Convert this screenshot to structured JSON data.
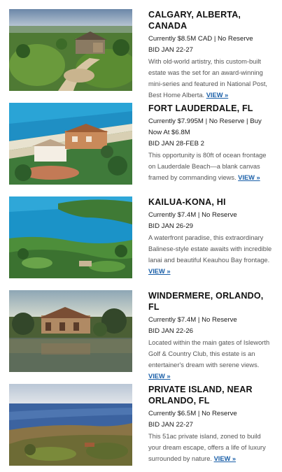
{
  "listings": [
    {
      "title": "CALGARY, ALBERTA, CANADA",
      "price": "Currently $8.5M CAD | No Reserve",
      "bid": "BID JAN 22-27",
      "description": "With old-world artistry, this custom-built estate was the set for an award-winning mini-series and featured in National Post, Best Home Alberta.",
      "link": "VIEW »",
      "image": "calgary-estate-photo"
    },
    {
      "title": "FORT LAUDERDALE, FL",
      "price": "Currently $7.995M | No Reserve | Buy Now At $6.8M",
      "bid": "BID JAN 28-FEB 2",
      "description": "This opportunity is 80ft of ocean frontage on Lauderdale Beach—a blank canvas framed by commanding views.",
      "link": "VIEW »",
      "image": "fort-lauderdale-beach-photo"
    },
    {
      "title": "KAILUA-KONA, HI",
      "price": "Currently $7.4M | No Reserve",
      "bid": "BID JAN 26-29",
      "description": "A waterfront paradise, this extraordinary Balinese-style estate awaits with incredible lanai and beautiful Keauhou Bay frontage.",
      "link": "VIEW »",
      "image": "kailua-kona-bay-photo"
    },
    {
      "title": "WINDERMERE, ORLANDO, FL",
      "price": "Currently $7.4M | No Reserve",
      "bid": "BID JAN 22-26",
      "description": "Located within the main gates of Isleworth Golf & Country Club, this estate is an entertainer's dream with serene views.",
      "link": "VIEW »",
      "image": "windermere-lakefront-photo"
    },
    {
      "title": "PRIVATE ISLAND, NEAR ORLANDO, FL",
      "price": "Currently $6.5M | No Reserve",
      "bid": "BID JAN 22-27",
      "description": "This 51ac private island, zoned to build your dream escape, offers a life of luxury surrounded by nature.",
      "link": "VIEW »",
      "image": "private-island-aerial-photo"
    }
  ]
}
